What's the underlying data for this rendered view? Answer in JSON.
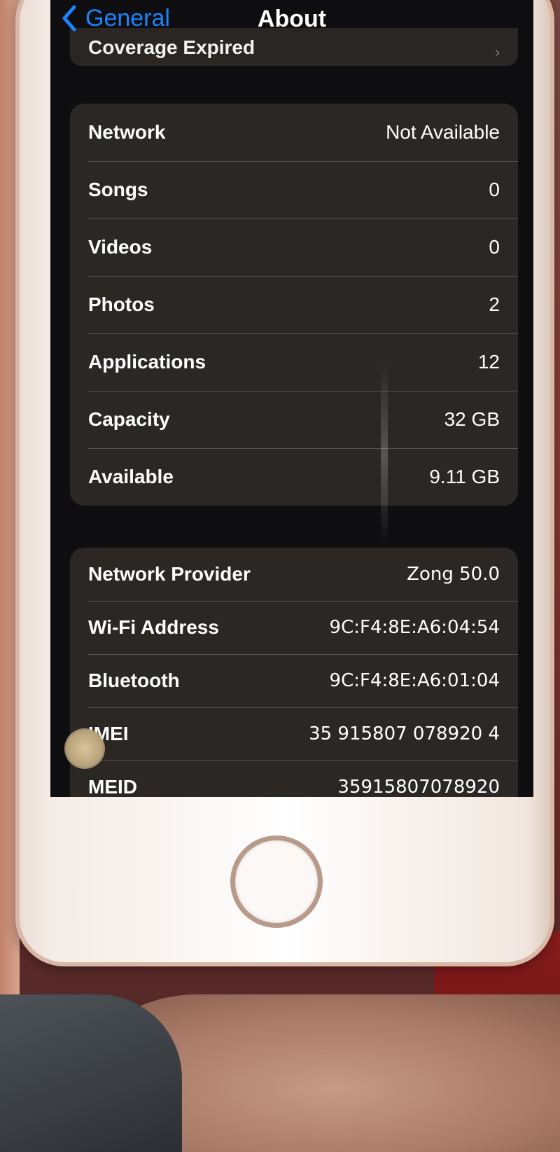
{
  "nav": {
    "back_label": "General",
    "title": "About"
  },
  "partial_row": {
    "label": "Coverage Expired"
  },
  "group1": {
    "rows": [
      {
        "label": "Network",
        "value": "Not Available"
      },
      {
        "label": "Songs",
        "value": "0"
      },
      {
        "label": "Videos",
        "value": "0"
      },
      {
        "label": "Photos",
        "value": "2"
      },
      {
        "label": "Applications",
        "value": "12"
      },
      {
        "label": "Capacity",
        "value": "32 GB"
      },
      {
        "label": "Available",
        "value": "9.11 GB"
      }
    ]
  },
  "group2": {
    "rows": [
      {
        "label": "Network Provider",
        "value": "Zong 50.0"
      },
      {
        "label": "Wi-Fi Address",
        "value": "9C:F4:8E:A6:04:54"
      },
      {
        "label": "Bluetooth",
        "value": "9C:F4:8E:A6:01:04"
      },
      {
        "label": "IMEI",
        "value": "35 915807 078920 4"
      },
      {
        "label": "MEID",
        "value": "35915807078920"
      }
    ]
  },
  "colors": {
    "accent": "#1a84ff",
    "screen_bg": "#0e0e10",
    "cell_bg": "#2b2725"
  },
  "icons": {
    "back": "chevron-left-icon",
    "disclosure": "chevron-right-icon"
  }
}
